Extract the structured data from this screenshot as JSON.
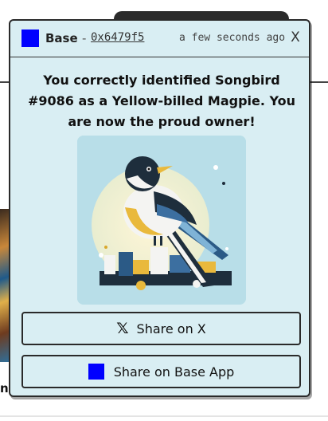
{
  "toast": {
    "brand_name": "Base",
    "separator": "-",
    "address": "0x6479f5",
    "timestamp": "a few seconds ago",
    "close_label": "X",
    "message": "You correctly identified Songbird #9086 as a Yellow-billed Magpie. You are now the proud owner!",
    "buttons": {
      "share_x": "Share on X",
      "share_base": "Share on Base App"
    }
  },
  "background": {
    "text_fragment": "n"
  },
  "colors": {
    "toast_bg": "#d9eef3",
    "brand_blue": "#0000ff",
    "border": "#2a2a2a"
  },
  "icons": {
    "brand": "base-logo-square",
    "close": "close-icon",
    "x": "x-logo-icon",
    "base_app": "base-logo-square"
  }
}
